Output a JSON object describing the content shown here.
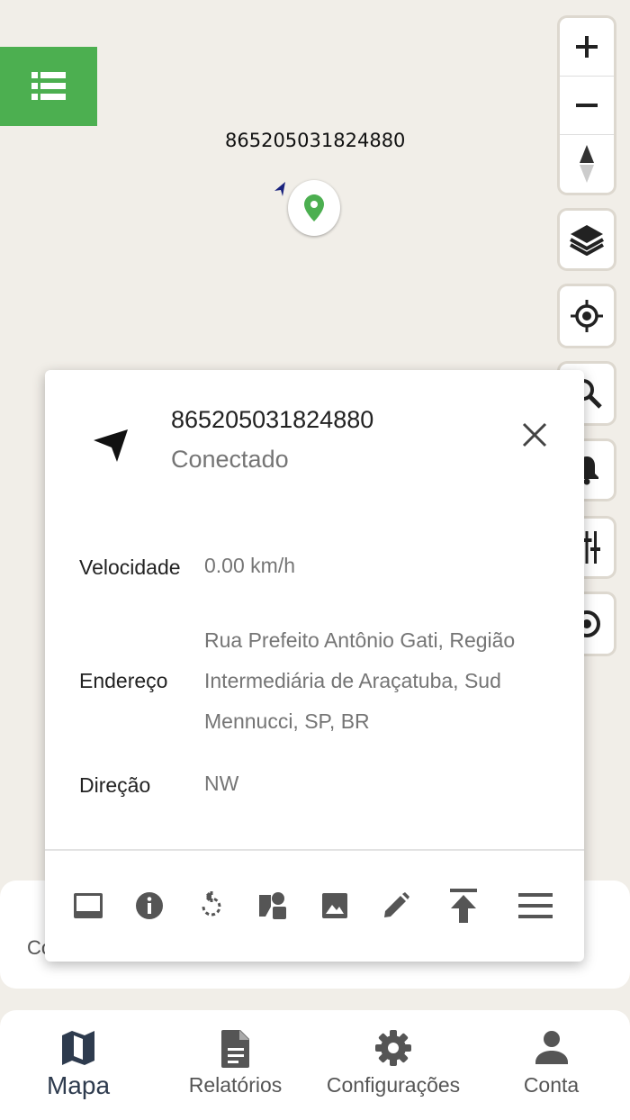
{
  "map": {
    "device_label": "865205031824880"
  },
  "controls": {
    "zoom_in_icon": "plus-icon",
    "zoom_out_icon": "minus-icon",
    "compass_icon": "compass-icon",
    "layers_icon": "layers-icon",
    "locate_icon": "crosshair-icon",
    "search_icon": "search-icon",
    "notifications_icon": "bell-icon",
    "filter_icon": "tune-icon",
    "replay_icon": "record-icon"
  },
  "popup": {
    "title": "865205031824880",
    "status": "Conectado",
    "rows": [
      {
        "label": "Velocidade",
        "value": "0.00 km/h"
      },
      {
        "label": "Endereço",
        "value": "Rua Prefeito Antônio Gati, Região Intermediária de Araçatuba, Sud Mennucci, SP, BR"
      },
      {
        "label": "Direção",
        "value": "NW"
      }
    ],
    "actions": [
      "panel-icon",
      "info-icon",
      "replay-icon",
      "geofence-icon",
      "image-icon",
      "edit-icon",
      "publish-icon",
      "menu-icon"
    ]
  },
  "bottom_sheet": {
    "text": "Co"
  },
  "bottom_nav": {
    "items": [
      {
        "label": "Mapa",
        "icon": "map-icon",
        "active": true
      },
      {
        "label": "Relatórios",
        "icon": "document-icon"
      },
      {
        "label": "Configurações",
        "icon": "gear-icon"
      },
      {
        "label": "Conta",
        "icon": "person-icon"
      }
    ]
  },
  "colors": {
    "map_bg": "#f1eee8",
    "accent": "#4caf50",
    "active_nav": "#2e3b4e",
    "muted_text": "#757575"
  }
}
